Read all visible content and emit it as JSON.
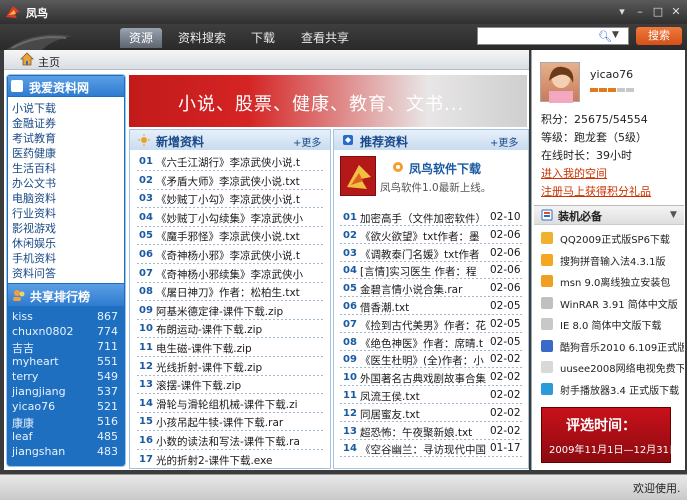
{
  "window": {
    "title": "凤鸟",
    "buttons": [
      "▾",
      "–",
      "□",
      "✕"
    ]
  },
  "nav": {
    "tabs": [
      "资源",
      "资料搜索",
      "下载",
      "查看共享"
    ],
    "active": 0
  },
  "search": {
    "placeholder": "",
    "button": "搜索"
  },
  "breadcrumb": {
    "home": "主页"
  },
  "sidebar": {
    "title": "我爱资料网",
    "categories": [
      "小说下载",
      "金融证券",
      "考试教育",
      "医药健康",
      "生活百科",
      "办公文书",
      "电脑资料",
      "行业资料",
      "影视游戏",
      "休闲娱乐",
      "手机资料",
      "资料问答"
    ],
    "ranking_title": "共享排行榜",
    "ranking": [
      {
        "name": "kiss",
        "value": "867"
      },
      {
        "name": "chuxn0802",
        "value": "774"
      },
      {
        "name": "吉吉",
        "value": "711"
      },
      {
        "name": "myheart",
        "value": "551"
      },
      {
        "name": "terry",
        "value": "549"
      },
      {
        "name": "jiangjiang",
        "value": "537"
      },
      {
        "name": "yicao76",
        "value": "521"
      },
      {
        "name": "康康",
        "value": "516"
      },
      {
        "name": "leaf",
        "value": "485"
      },
      {
        "name": "jiangshan",
        "value": "483"
      }
    ]
  },
  "banner": {
    "text": "小说、股票、健康、教育、文书..."
  },
  "new_panel": {
    "title": "新增资料",
    "more": "+更多",
    "items": [
      {
        "num": "01",
        "text": "《六壬江湖行》李凉武侠小说.t"
      },
      {
        "num": "02",
        "text": "《矛盾大师》李凉武侠小说.txt"
      },
      {
        "num": "03",
        "text": "《妙贼丁小勾》李凉武侠小说.t"
      },
      {
        "num": "04",
        "text": "《妙贼丁小勾续集》李凉武侠小"
      },
      {
        "num": "05",
        "text": "《魔手邪怪》李凉武侠小说.txt"
      },
      {
        "num": "06",
        "text": "《奇神杨小邪》李凉武侠小说.t"
      },
      {
        "num": "07",
        "text": "《奇神杨小邪续集》李凉武侠小"
      },
      {
        "num": "08",
        "text": "《屠日神刀》作者：松柏生.txt"
      },
      {
        "num": "09",
        "text": "阿基米德定律-课件下载.zip"
      },
      {
        "num": "10",
        "text": "布朗运动-课件下载.zip"
      },
      {
        "num": "11",
        "text": "电生磁-课件下载.zip"
      },
      {
        "num": "12",
        "text": "光线折射-课件下载.zip"
      },
      {
        "num": "13",
        "text": "滚摆-课件下载.zip"
      },
      {
        "num": "14",
        "text": "滑轮与滑轮组机械-课件下载.zi"
      },
      {
        "num": "15",
        "text": "小孩吊起牛犊-课件下载.rar"
      },
      {
        "num": "16",
        "text": "小数的读法和写法-课件下载.ra"
      },
      {
        "num": "17",
        "text": "光的折射2-课件下载.exe"
      }
    ]
  },
  "rec_panel": {
    "title": "推荐资料",
    "more": "+更多",
    "feature_title": "凤鸟软件下载",
    "feature_desc": "凤鸟软件1.0最新上线。",
    "items": [
      {
        "num": "01",
        "text": "加密高手（文件加密软件）",
        "date": "02-10"
      },
      {
        "num": "02",
        "text": "《欲火欲望》txt作者：墨",
        "date": "02-06"
      },
      {
        "num": "03",
        "text": "《调教泰门名媛》txt作者",
        "date": "02-06"
      },
      {
        "num": "04",
        "text": "[言情]实习医生 作者：程",
        "date": "02-06"
      },
      {
        "num": "05",
        "text": "金碧言情小说合集.rar",
        "date": "02-06"
      },
      {
        "num": "06",
        "text": "借香潮.txt",
        "date": "02-05"
      },
      {
        "num": "07",
        "text": "《捡到古代美男》作者：花",
        "date": "02-05"
      },
      {
        "num": "08",
        "text": "《绝色神医》作者：席晴.t",
        "date": "02-05"
      },
      {
        "num": "09",
        "text": "《医生杜明》(全)作者：小",
        "date": "02-02"
      },
      {
        "num": "10",
        "text": "外国著名古典戏剧故事合集",
        "date": "02-02"
      },
      {
        "num": "11",
        "text": "凤流王侯.txt",
        "date": "02-02"
      },
      {
        "num": "12",
        "text": "同居蜜友.txt",
        "date": "02-02"
      },
      {
        "num": "13",
        "text": "超恐怖：午夜聚新娘.txt",
        "date": "02-02"
      },
      {
        "num": "14",
        "text": "《空谷幽兰：寻访现代中国",
        "date": "01-17"
      }
    ]
  },
  "user": {
    "name": "yicao76",
    "points": "积分：25675/54554",
    "level": "等级：跑龙套（5级）",
    "online": "在线时长：39小时",
    "link1": "进入我的空间",
    "link2": "注册马上获得积分礼品",
    "colors": {
      "filled": "#e07a1a",
      "empty": "#c8c8c8"
    }
  },
  "install": {
    "title": "装机必备",
    "items": [
      {
        "text": "QQ2009正式版SP6下载",
        "icon": "qq-icon"
      },
      {
        "text": "搜狗拼音输入法4.3.1版",
        "icon": "sogou-icon"
      },
      {
        "text": "msn 9.0离线独立安装包",
        "icon": "msn-icon"
      },
      {
        "text": "WinRAR 3.91 简体中文版",
        "icon": "winrar-icon"
      },
      {
        "text": "IE 8.0 简体中文版下载",
        "icon": "ie-icon"
      },
      {
        "text": "酷狗音乐2010 6.109正式版",
        "icon": "kugou-icon"
      },
      {
        "text": "uusee2008网络电视免费下载",
        "icon": "uusee-icon"
      },
      {
        "text": "射手播放器3.4 正式版下载",
        "icon": "player-icon"
      }
    ]
  },
  "ad": {
    "line1": "评选时间：",
    "line2": "2009年11月1日—12月31日"
  },
  "status": {
    "text": "欢迎使用."
  }
}
